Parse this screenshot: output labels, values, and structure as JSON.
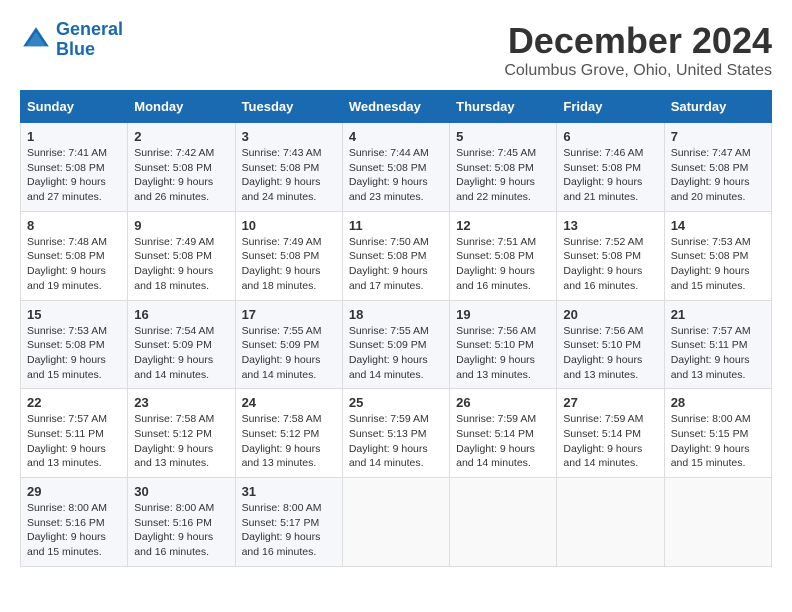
{
  "header": {
    "logo_line1": "General",
    "logo_line2": "Blue",
    "title": "December 2024",
    "subtitle": "Columbus Grove, Ohio, United States"
  },
  "columns": [
    "Sunday",
    "Monday",
    "Tuesday",
    "Wednesday",
    "Thursday",
    "Friday",
    "Saturday"
  ],
  "weeks": [
    [
      {
        "day": "1",
        "sunrise": "Sunrise: 7:41 AM",
        "sunset": "Sunset: 5:08 PM",
        "daylight": "Daylight: 9 hours and 27 minutes."
      },
      {
        "day": "2",
        "sunrise": "Sunrise: 7:42 AM",
        "sunset": "Sunset: 5:08 PM",
        "daylight": "Daylight: 9 hours and 26 minutes."
      },
      {
        "day": "3",
        "sunrise": "Sunrise: 7:43 AM",
        "sunset": "Sunset: 5:08 PM",
        "daylight": "Daylight: 9 hours and 24 minutes."
      },
      {
        "day": "4",
        "sunrise": "Sunrise: 7:44 AM",
        "sunset": "Sunset: 5:08 PM",
        "daylight": "Daylight: 9 hours and 23 minutes."
      },
      {
        "day": "5",
        "sunrise": "Sunrise: 7:45 AM",
        "sunset": "Sunset: 5:08 PM",
        "daylight": "Daylight: 9 hours and 22 minutes."
      },
      {
        "day": "6",
        "sunrise": "Sunrise: 7:46 AM",
        "sunset": "Sunset: 5:08 PM",
        "daylight": "Daylight: 9 hours and 21 minutes."
      },
      {
        "day": "7",
        "sunrise": "Sunrise: 7:47 AM",
        "sunset": "Sunset: 5:08 PM",
        "daylight": "Daylight: 9 hours and 20 minutes."
      }
    ],
    [
      {
        "day": "8",
        "sunrise": "Sunrise: 7:48 AM",
        "sunset": "Sunset: 5:08 PM",
        "daylight": "Daylight: 9 hours and 19 minutes."
      },
      {
        "day": "9",
        "sunrise": "Sunrise: 7:49 AM",
        "sunset": "Sunset: 5:08 PM",
        "daylight": "Daylight: 9 hours and 18 minutes."
      },
      {
        "day": "10",
        "sunrise": "Sunrise: 7:49 AM",
        "sunset": "Sunset: 5:08 PM",
        "daylight": "Daylight: 9 hours and 18 minutes."
      },
      {
        "day": "11",
        "sunrise": "Sunrise: 7:50 AM",
        "sunset": "Sunset: 5:08 PM",
        "daylight": "Daylight: 9 hours and 17 minutes."
      },
      {
        "day": "12",
        "sunrise": "Sunrise: 7:51 AM",
        "sunset": "Sunset: 5:08 PM",
        "daylight": "Daylight: 9 hours and 16 minutes."
      },
      {
        "day": "13",
        "sunrise": "Sunrise: 7:52 AM",
        "sunset": "Sunset: 5:08 PM",
        "daylight": "Daylight: 9 hours and 16 minutes."
      },
      {
        "day": "14",
        "sunrise": "Sunrise: 7:53 AM",
        "sunset": "Sunset: 5:08 PM",
        "daylight": "Daylight: 9 hours and 15 minutes."
      }
    ],
    [
      {
        "day": "15",
        "sunrise": "Sunrise: 7:53 AM",
        "sunset": "Sunset: 5:08 PM",
        "daylight": "Daylight: 9 hours and 15 minutes."
      },
      {
        "day": "16",
        "sunrise": "Sunrise: 7:54 AM",
        "sunset": "Sunset: 5:09 PM",
        "daylight": "Daylight: 9 hours and 14 minutes."
      },
      {
        "day": "17",
        "sunrise": "Sunrise: 7:55 AM",
        "sunset": "Sunset: 5:09 PM",
        "daylight": "Daylight: 9 hours and 14 minutes."
      },
      {
        "day": "18",
        "sunrise": "Sunrise: 7:55 AM",
        "sunset": "Sunset: 5:09 PM",
        "daylight": "Daylight: 9 hours and 14 minutes."
      },
      {
        "day": "19",
        "sunrise": "Sunrise: 7:56 AM",
        "sunset": "Sunset: 5:10 PM",
        "daylight": "Daylight: 9 hours and 13 minutes."
      },
      {
        "day": "20",
        "sunrise": "Sunrise: 7:56 AM",
        "sunset": "Sunset: 5:10 PM",
        "daylight": "Daylight: 9 hours and 13 minutes."
      },
      {
        "day": "21",
        "sunrise": "Sunrise: 7:57 AM",
        "sunset": "Sunset: 5:11 PM",
        "daylight": "Daylight: 9 hours and 13 minutes."
      }
    ],
    [
      {
        "day": "22",
        "sunrise": "Sunrise: 7:57 AM",
        "sunset": "Sunset: 5:11 PM",
        "daylight": "Daylight: 9 hours and 13 minutes."
      },
      {
        "day": "23",
        "sunrise": "Sunrise: 7:58 AM",
        "sunset": "Sunset: 5:12 PM",
        "daylight": "Daylight: 9 hours and 13 minutes."
      },
      {
        "day": "24",
        "sunrise": "Sunrise: 7:58 AM",
        "sunset": "Sunset: 5:12 PM",
        "daylight": "Daylight: 9 hours and 13 minutes."
      },
      {
        "day": "25",
        "sunrise": "Sunrise: 7:59 AM",
        "sunset": "Sunset: 5:13 PM",
        "daylight": "Daylight: 9 hours and 14 minutes."
      },
      {
        "day": "26",
        "sunrise": "Sunrise: 7:59 AM",
        "sunset": "Sunset: 5:14 PM",
        "daylight": "Daylight: 9 hours and 14 minutes."
      },
      {
        "day": "27",
        "sunrise": "Sunrise: 7:59 AM",
        "sunset": "Sunset: 5:14 PM",
        "daylight": "Daylight: 9 hours and 14 minutes."
      },
      {
        "day": "28",
        "sunrise": "Sunrise: 8:00 AM",
        "sunset": "Sunset: 5:15 PM",
        "daylight": "Daylight: 9 hours and 15 minutes."
      }
    ],
    [
      {
        "day": "29",
        "sunrise": "Sunrise: 8:00 AM",
        "sunset": "Sunset: 5:16 PM",
        "daylight": "Daylight: 9 hours and 15 minutes."
      },
      {
        "day": "30",
        "sunrise": "Sunrise: 8:00 AM",
        "sunset": "Sunset: 5:16 PM",
        "daylight": "Daylight: 9 hours and 16 minutes."
      },
      {
        "day": "31",
        "sunrise": "Sunrise: 8:00 AM",
        "sunset": "Sunset: 5:17 PM",
        "daylight": "Daylight: 9 hours and 16 minutes."
      },
      null,
      null,
      null,
      null
    ]
  ]
}
